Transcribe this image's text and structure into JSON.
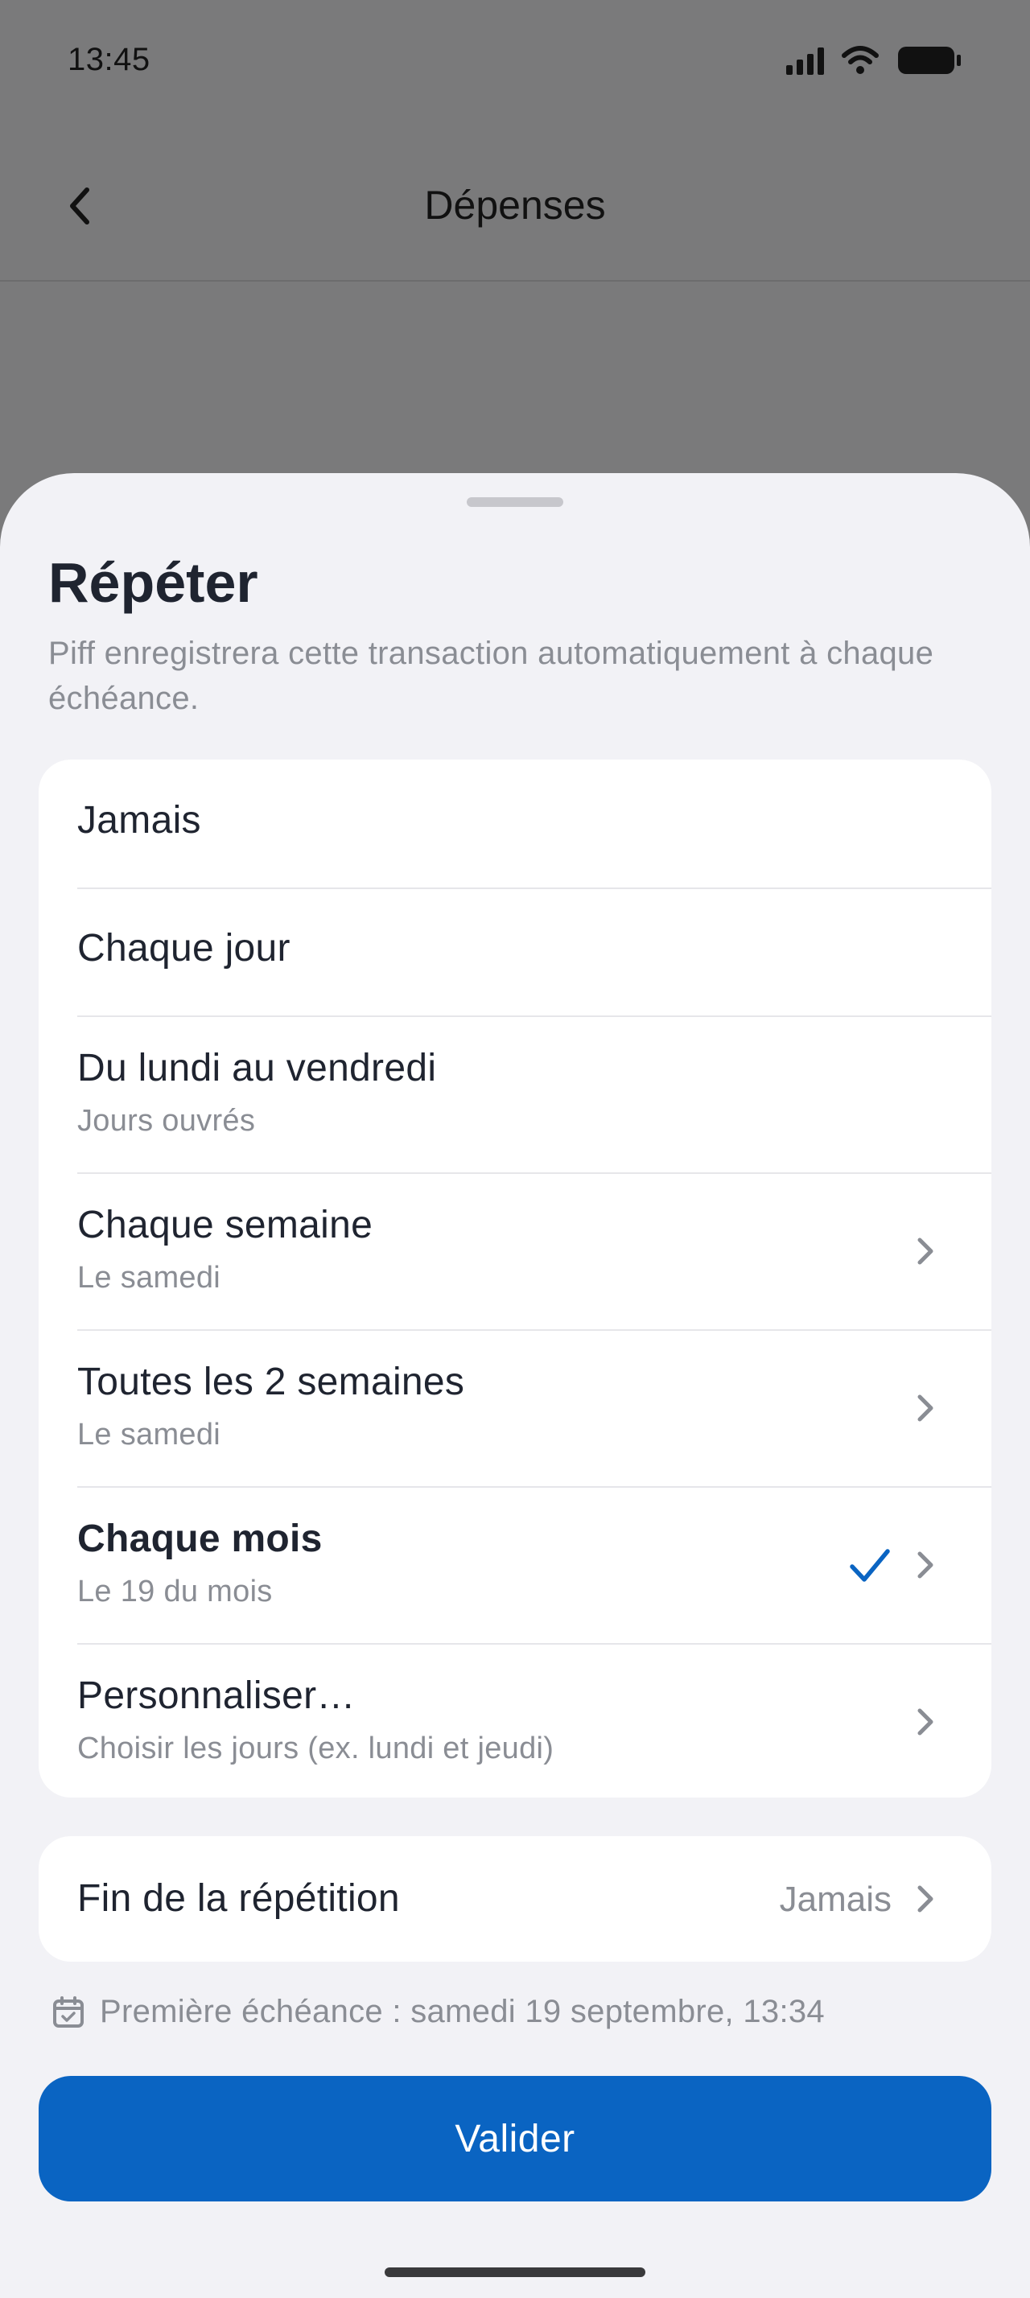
{
  "status_bar": {
    "time": "13:45",
    "icons": [
      "signal-icon",
      "wifi-icon",
      "battery-icon"
    ]
  },
  "nav": {
    "title": "Dépenses",
    "back_icon": "chevron-left-icon"
  },
  "sheet": {
    "title": "Répéter",
    "subtitle": "Piff enregistrera cette transaction automatiquement à chaque échéance.",
    "options": [
      {
        "label": "Jamais"
      },
      {
        "label": "Chaque jour"
      },
      {
        "label": "Du lundi au vendredi",
        "sub": "Jours ouvrés"
      },
      {
        "label": "Chaque semaine",
        "sub": "Le samedi"
      },
      {
        "label": "Toutes les 2 semaines",
        "sub": "Le samedi"
      },
      {
        "label": "Chaque mois",
        "sub": "Le 19 du mois",
        "selected": true
      },
      {
        "label": "Personnaliser…",
        "sub": "Choisir les jours (ex. lundi et jeudi)"
      }
    ],
    "end_repeat": {
      "label": "Fin de la répétition",
      "value": "Jamais"
    },
    "first_due": "Première échéance : samedi 19 septembre, 13:34",
    "validate_label": "Valider"
  },
  "colors": {
    "accent": "#0a64c2",
    "sheet_bg": "#f2f2f6",
    "overlay": "#7a7a7b",
    "secondary_text": "#8a8d94"
  }
}
